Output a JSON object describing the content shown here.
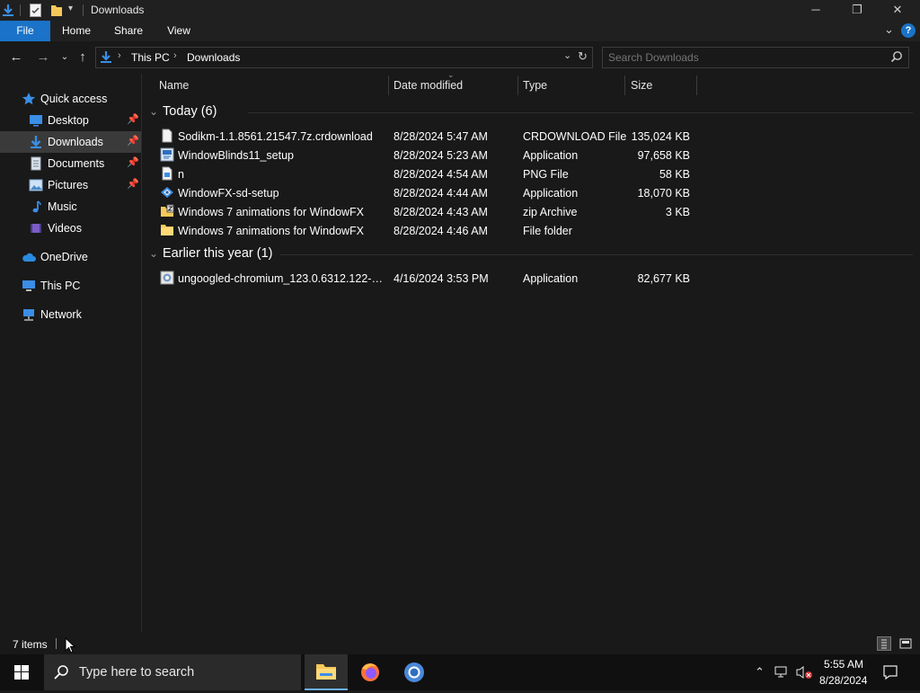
{
  "window": {
    "title": "Downloads"
  },
  "ribbon": {
    "tabs": [
      "File",
      "Home",
      "Share",
      "View"
    ]
  },
  "address": {
    "segments": [
      "This PC",
      "Downloads"
    ]
  },
  "search": {
    "placeholder": "Search Downloads"
  },
  "nav": {
    "items": [
      {
        "label": "Quick access",
        "icon": "star-icon"
      },
      {
        "label": "Desktop",
        "icon": "desktop-icon",
        "pinned": true
      },
      {
        "label": "Downloads",
        "icon": "download-icon",
        "pinned": true,
        "selected": true
      },
      {
        "label": "Documents",
        "icon": "documents-icon",
        "pinned": true
      },
      {
        "label": "Pictures",
        "icon": "pictures-icon",
        "pinned": true
      },
      {
        "label": "Music",
        "icon": "music-icon"
      },
      {
        "label": "Videos",
        "icon": "videos-icon"
      },
      {
        "label": "OneDrive",
        "icon": "cloud-icon"
      },
      {
        "label": "This PC",
        "icon": "computer-icon"
      },
      {
        "label": "Network",
        "icon": "network-icon"
      }
    ]
  },
  "columns": {
    "name": "Name",
    "date": "Date modified",
    "type": "Type",
    "size": "Size"
  },
  "groups": [
    {
      "label": "Today (6)",
      "files": [
        {
          "name": "Sodikm-1.1.8561.21547.7z.crdownload",
          "date": "8/28/2024 5:47 AM",
          "type": "CRDOWNLOAD File",
          "size": "135,024 KB",
          "icon": "file-icon"
        },
        {
          "name": "WindowBlinds11_setup",
          "date": "8/28/2024 5:23 AM",
          "type": "Application",
          "size": "97,658 KB",
          "icon": "installer-icon"
        },
        {
          "name": "n",
          "date": "8/28/2024 4:54 AM",
          "type": "PNG File",
          "size": "58 KB",
          "icon": "image-file-icon"
        },
        {
          "name": "WindowFX-sd-setup",
          "date": "8/28/2024 4:44 AM",
          "type": "Application",
          "size": "18,070 KB",
          "icon": "setup-icon"
        },
        {
          "name": "Windows 7 animations for WindowFX",
          "date": "8/28/2024 4:43 AM",
          "type": "zip Archive",
          "size": "3 KB",
          "icon": "zip-icon"
        },
        {
          "name": "Windows 7 animations for WindowFX",
          "date": "8/28/2024 4:46 AM",
          "type": "File folder",
          "size": "",
          "icon": "folder-icon"
        }
      ]
    },
    {
      "label": "Earlier this year (1)",
      "files": [
        {
          "name": "ungoogled-chromium_123.0.6312.122-1....",
          "date": "4/16/2024 3:53 PM",
          "type": "Application",
          "size": "82,677 KB",
          "icon": "chromium-installer-icon"
        }
      ]
    }
  ],
  "status": {
    "items": "7 items"
  },
  "taskbar": {
    "search_placeholder": "Type here to search",
    "time": "5:55 AM",
    "date": "8/28/2024"
  },
  "colors": {
    "accent": "#1a73c8",
    "folder": "#f6c85a",
    "background": "#191919"
  }
}
